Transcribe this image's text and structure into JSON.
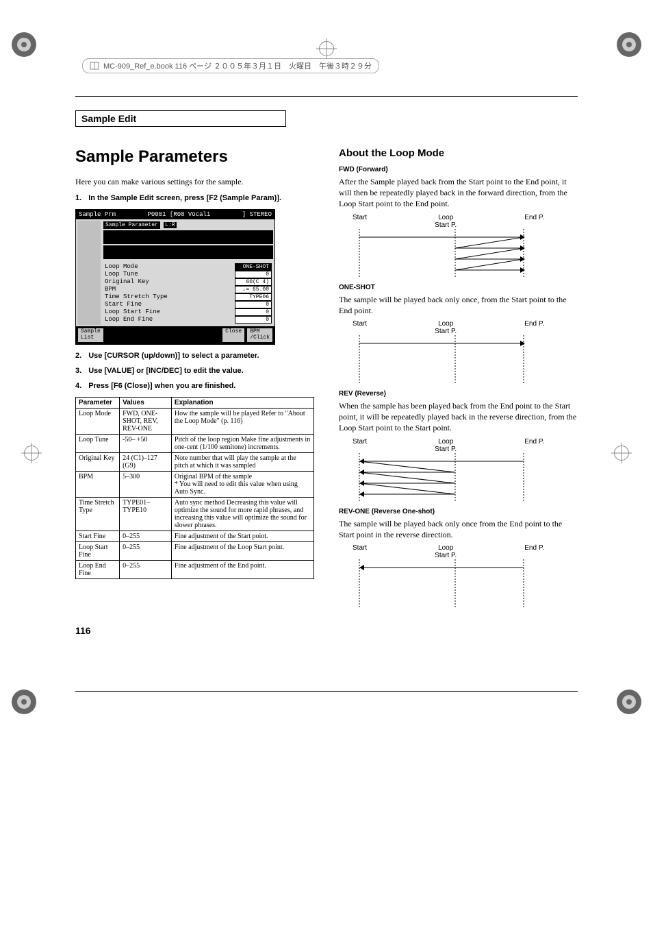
{
  "header": {
    "file_info": "MC-909_Ref_e.book 116 ページ ２００５年３月１日　火曜日　午後３時２９分"
  },
  "section_title": "Sample Edit",
  "left": {
    "heading": "Sample Parameters",
    "intro": "Here you can make various settings for the sample.",
    "steps": [
      "In the Sample Edit screen, press [F2 (Sample Param)].",
      "Use [CURSOR (up/down)] to select a parameter.",
      "Use [VALUE] or [INC/DEC] to edit the value.",
      "Press [F6 (Close)] when you are finished."
    ],
    "screenshot": {
      "title_left": "Sample Prm",
      "title_mid": "P0001 [R08 Vocal1",
      "title_right": "] STEREO",
      "panel_label": "Sample Parameter",
      "lr_label": "L:R",
      "params": [
        {
          "name": "Loop Mode",
          "value": "ONE-SHOT",
          "hl": true
        },
        {
          "name": "Loop Tune",
          "value": "0"
        },
        {
          "name": "Original Key",
          "value": "60(C 4)"
        },
        {
          "name": "BPM",
          "value": "♩= 65.00"
        },
        {
          "name": "Time Stretch Type",
          "value": "TYPE06"
        },
        {
          "name": "Start Fine",
          "value": "0"
        },
        {
          "name": "Loop Start Fine",
          "value": "0"
        },
        {
          "name": "Loop End Fine",
          "value": "0"
        }
      ],
      "btn_left": "Sample\nList",
      "btn_close": "Close",
      "btn_bpm": "BPM\n/Click"
    },
    "table": {
      "headers": [
        "Parameter",
        "Values",
        "Explanation"
      ],
      "rows": [
        {
          "p": "Loop Mode",
          "v": "FWD, ONE-SHOT, REV, REV-ONE",
          "e": "How the sample will be played Refer to \"About the Loop Mode\" (p. 116)"
        },
        {
          "p": "Loop Tune",
          "v": "-50– +50",
          "e": "Pitch of the loop region Make fine adjustments in one-cent (1/100 semitone) increments."
        },
        {
          "p": "Original Key",
          "v": "24 (C1)–127 (G9)",
          "e": "Note number that will play the sample at the pitch at which it was sampled"
        },
        {
          "p": "BPM",
          "v": "5–300",
          "e": "Original BPM of the sample\n* You will need to edit this value when using Auto Sync."
        },
        {
          "p": "Time Stretch Type",
          "v": "TYPE01–TYPE10",
          "e": "Auto sync method Decreasing this value will optimize the sound for more rapid phrases, and increasing this value will optimize the sound for slower phrases."
        },
        {
          "p": "Start Fine",
          "v": "0–255",
          "e": "Fine adjustment of the Start point."
        },
        {
          "p": "Loop Start Fine",
          "v": "0–255",
          "e": "Fine adjustment of the Loop Start point."
        },
        {
          "p": "Loop End Fine",
          "v": "0–255",
          "e": "Fine adjustment of the End point."
        }
      ]
    }
  },
  "right": {
    "heading": "About the Loop Mode",
    "modes": [
      {
        "title": "FWD (Forward)",
        "desc": "After the Sample played back from the Start point to the End point, it will then be repeatedly played back in the forward direction, from the Loop Start point to the End point.",
        "labels": {
          "start": "Start",
          "loop": "Loop\nStart P.",
          "end": "End P."
        }
      },
      {
        "title": "ONE-SHOT",
        "desc": "The sample will be played back only once, from the Start point to the End point.",
        "labels": {
          "start": "Start",
          "loop": "Loop\nStart P.",
          "end": "End P."
        }
      },
      {
        "title": "REV (Reverse)",
        "desc": "When the sample has been played back from the End point to the Start point, it will be repeatedly played back in the reverse direction, from the Loop Start point to the Start point.",
        "labels": {
          "start": "Start",
          "loop": "Loop\nStart P.",
          "end": "End P."
        }
      },
      {
        "title": "REV-ONE (Reverse One-shot)",
        "desc": "The sample will be played back only once from the End point to the Start point in the reverse direction.",
        "labels": {
          "start": "Start",
          "loop": "Loop\nStart P.",
          "end": "End P."
        }
      }
    ]
  },
  "page_number": "116"
}
